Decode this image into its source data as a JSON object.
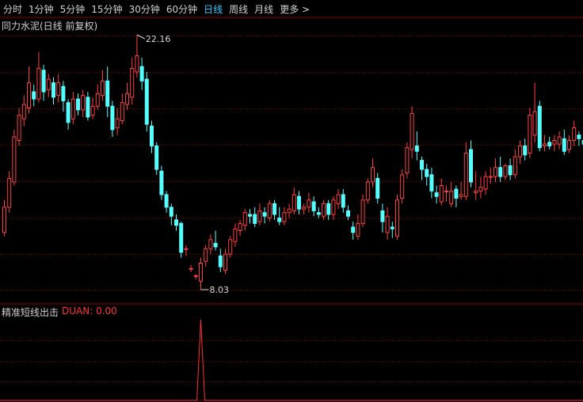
{
  "toolbar": {
    "tabs": [
      {
        "label": "分时",
        "active": false
      },
      {
        "label": "1分钟",
        "active": false
      },
      {
        "label": "5分钟",
        "active": false
      },
      {
        "label": "15分钟",
        "active": false
      },
      {
        "label": "30分钟",
        "active": false
      },
      {
        "label": "60分钟",
        "active": false
      },
      {
        "label": "日线",
        "active": true
      },
      {
        "label": "周线",
        "active": false
      },
      {
        "label": "月线",
        "active": false
      },
      {
        "label": "更多 >",
        "active": false
      }
    ]
  },
  "main_chart": {
    "title": "同力水泥(日线 前复权)",
    "high_label": "22.16",
    "low_label": "8.03"
  },
  "indicator": {
    "title": "精准短线出击",
    "value_label": "DUAN: 0.00"
  },
  "colors": {
    "up": "#ff4040",
    "down": "#54ffff",
    "grid": "#8b0000",
    "active_tab": "#31c8ff",
    "indicator_line": "#ff3030"
  },
  "chart_data": {
    "type": "candlestick",
    "price_range": [
      8.03,
      22.16
    ],
    "candles": [
      [
        11.2,
        12.6,
        13.0,
        11.0
      ],
      [
        12.6,
        14.2,
        14.6,
        12.3
      ],
      [
        14.0,
        16.5,
        16.9,
        13.8
      ],
      [
        16.3,
        17.7,
        18.1,
        16.0
      ],
      [
        17.5,
        18.3,
        18.8,
        17.1
      ],
      [
        18.1,
        19.5,
        20.4,
        17.8
      ],
      [
        19.0,
        18.6,
        19.4,
        18.2
      ],
      [
        18.6,
        20.3,
        21.2,
        18.4
      ],
      [
        20.2,
        19.0,
        20.5,
        18.5
      ],
      [
        19.1,
        19.7,
        20.0,
        18.7
      ],
      [
        19.5,
        18.7,
        19.8,
        18.3
      ],
      [
        18.8,
        19.5,
        20.0,
        18.4
      ],
      [
        19.3,
        18.5,
        19.6,
        17.9
      ],
      [
        18.4,
        17.3,
        18.6,
        16.9
      ],
      [
        17.5,
        18.6,
        19.0,
        17.2
      ],
      [
        18.6,
        18.0,
        18.9,
        17.7
      ],
      [
        18.0,
        18.8,
        19.1,
        17.6
      ],
      [
        18.7,
        17.6,
        19.0,
        17.4
      ],
      [
        17.7,
        18.2,
        18.7,
        17.5
      ],
      [
        18.2,
        18.9,
        19.4,
        18.0
      ],
      [
        18.8,
        19.6,
        20.2,
        18.5
      ],
      [
        19.6,
        18.2,
        20.4,
        17.6
      ],
      [
        18.2,
        16.9,
        18.5,
        16.5
      ],
      [
        17.0,
        17.5,
        18.1,
        16.6
      ],
      [
        17.4,
        18.4,
        18.9,
        17.2
      ],
      [
        18.3,
        18.9,
        19.5,
        18.0
      ],
      [
        18.7,
        20.3,
        20.9,
        18.3
      ],
      [
        20.1,
        21.0,
        22.16,
        19.8
      ],
      [
        20.4,
        19.6,
        20.9,
        19.1
      ],
      [
        19.7,
        17.2,
        20.1,
        16.8
      ],
      [
        17.1,
        16.0,
        17.4,
        15.6
      ],
      [
        16.0,
        14.7,
        16.2,
        14.4
      ],
      [
        14.6,
        13.3,
        14.9,
        13.0
      ],
      [
        13.3,
        12.6,
        13.5,
        12.3
      ],
      [
        12.6,
        12.1,
        12.8,
        11.6
      ],
      [
        11.9,
        11.6,
        12.2,
        11.3
      ],
      [
        11.7,
        10.1,
        11.8,
        9.8
      ],
      [
        10.3,
        10.3,
        10.5,
        9.9
      ],
      [
        9.2,
        9.2,
        9.4,
        9.0
      ],
      [
        8.8,
        8.8,
        8.9,
        8.6
      ],
      [
        8.5,
        9.5,
        9.8,
        8.03
      ],
      [
        9.6,
        10.3,
        10.5,
        9.3
      ],
      [
        10.3,
        10.8,
        11.1,
        10.0
      ],
      [
        10.6,
        10.4,
        11.3,
        10.2
      ],
      [
        9.9,
        9.3,
        10.3,
        9.0
      ],
      [
        9.1,
        10.0,
        10.3,
        8.9
      ],
      [
        10.0,
        10.8,
        11.0,
        9.8
      ],
      [
        10.7,
        11.4,
        11.7,
        10.4
      ],
      [
        11.3,
        11.7,
        11.9,
        11.0
      ],
      [
        11.6,
        12.3,
        12.5,
        11.3
      ],
      [
        12.2,
        12.1,
        12.5,
        11.7
      ],
      [
        12.2,
        11.7,
        12.6,
        11.5
      ],
      [
        11.8,
        12.4,
        12.8,
        11.6
      ],
      [
        12.3,
        12.1,
        12.6,
        11.7
      ],
      [
        12.0,
        12.8,
        13.0,
        11.8
      ],
      [
        12.8,
        12.2,
        13.0,
        11.9
      ],
      [
        12.0,
        11.8,
        12.6,
        11.6
      ],
      [
        11.8,
        12.3,
        12.6,
        11.6
      ],
      [
        12.3,
        12.5,
        12.8,
        12.0
      ],
      [
        12.4,
        13.3,
        13.7,
        12.2
      ],
      [
        13.2,
        12.5,
        13.5,
        12.2
      ],
      [
        12.5,
        12.6,
        12.8,
        12.2
      ],
      [
        12.6,
        13.0,
        13.4,
        12.3
      ],
      [
        12.9,
        12.4,
        13.2,
        12.1
      ],
      [
        12.3,
        12.2,
        12.6,
        12.0
      ],
      [
        12.1,
        12.8,
        13.0,
        11.9
      ],
      [
        12.8,
        12.2,
        13.0,
        11.9
      ],
      [
        12.2,
        13.0,
        13.2,
        11.9
      ],
      [
        12.8,
        13.3,
        13.6,
        12.5
      ],
      [
        13.3,
        12.6,
        13.6,
        12.3
      ],
      [
        12.4,
        12.1,
        12.7,
        11.9
      ],
      [
        11.5,
        11.2,
        11.8,
        10.8
      ],
      [
        11.0,
        11.7,
        12.2,
        10.8
      ],
      [
        11.7,
        13.0,
        13.3,
        11.5
      ],
      [
        13.0,
        14.0,
        14.2,
        12.8
      ],
      [
        14.0,
        14.8,
        15.3,
        13.7
      ],
      [
        14.2,
        13.1,
        14.5,
        12.8
      ],
      [
        12.4,
        11.8,
        12.8,
        11.2
      ],
      [
        11.2,
        12.1,
        12.6,
        10.8
      ],
      [
        11.5,
        11.4,
        11.8,
        10.9
      ],
      [
        11.0,
        13.0,
        13.3,
        10.8
      ],
      [
        13.1,
        14.4,
        14.7,
        12.8
      ],
      [
        14.5,
        15.9,
        16.2,
        14.2
      ],
      [
        15.8,
        17.8,
        18.2,
        15.3
      ],
      [
        16.0,
        15.7,
        16.8,
        15.2
      ],
      [
        15.2,
        14.7,
        15.4,
        14.1
      ],
      [
        14.7,
        14.3,
        15.0,
        13.8
      ],
      [
        14.4,
        13.5,
        14.8,
        13.1
      ],
      [
        13.4,
        13.2,
        13.8,
        12.8
      ],
      [
        12.9,
        13.8,
        14.2,
        12.7
      ],
      [
        13.5,
        13.5,
        13.8,
        12.9
      ],
      [
        12.8,
        13.5,
        14.0,
        12.6
      ],
      [
        13.6,
        13.1,
        13.8,
        12.6
      ],
      [
        13.2,
        13.3,
        14.0,
        13.0
      ],
      [
        13.2,
        15.6,
        16.2,
        13.0
      ],
      [
        15.8,
        14.0,
        16.3,
        13.7
      ],
      [
        13.4,
        13.5,
        14.6,
        13.0
      ],
      [
        13.5,
        13.7,
        14.3,
        13.1
      ],
      [
        13.6,
        14.3,
        14.6,
        13.3
      ],
      [
        14.3,
        14.3,
        14.8,
        13.9
      ],
      [
        14.3,
        14.8,
        15.3,
        14.0
      ],
      [
        14.8,
        14.3,
        15.4,
        14.0
      ],
      [
        14.3,
        14.9,
        15.0,
        14.1
      ],
      [
        14.9,
        14.4,
        15.3,
        14.1
      ],
      [
        14.4,
        15.4,
        15.8,
        14.2
      ],
      [
        15.4,
        16.0,
        16.3,
        15.0
      ],
      [
        16.0,
        15.5,
        16.4,
        15.2
      ],
      [
        15.6,
        17.7,
        18.1,
        15.3
      ],
      [
        16.6,
        17.9,
        19.5,
        16.2
      ],
      [
        18.2,
        15.9,
        18.5,
        15.7
      ],
      [
        16.0,
        16.1,
        16.6,
        15.7
      ],
      [
        16.2,
        16.0,
        16.5,
        15.8
      ],
      [
        16.1,
        16.3,
        16.6,
        15.7
      ],
      [
        16.1,
        16.5,
        16.8,
        15.8
      ],
      [
        16.4,
        15.7,
        16.9,
        15.5
      ],
      [
        15.8,
        16.3,
        16.6,
        15.6
      ],
      [
        16.3,
        17.0,
        17.4,
        16.0
      ],
      [
        16.6,
        16.4,
        16.8,
        16.0
      ],
      [
        16.3,
        16.1,
        16.5,
        15.8
      ]
    ],
    "indicator": {
      "name": "DUAN",
      "current_value": 0.0,
      "peak_candle_index": 40,
      "peak_value": 1
    }
  }
}
